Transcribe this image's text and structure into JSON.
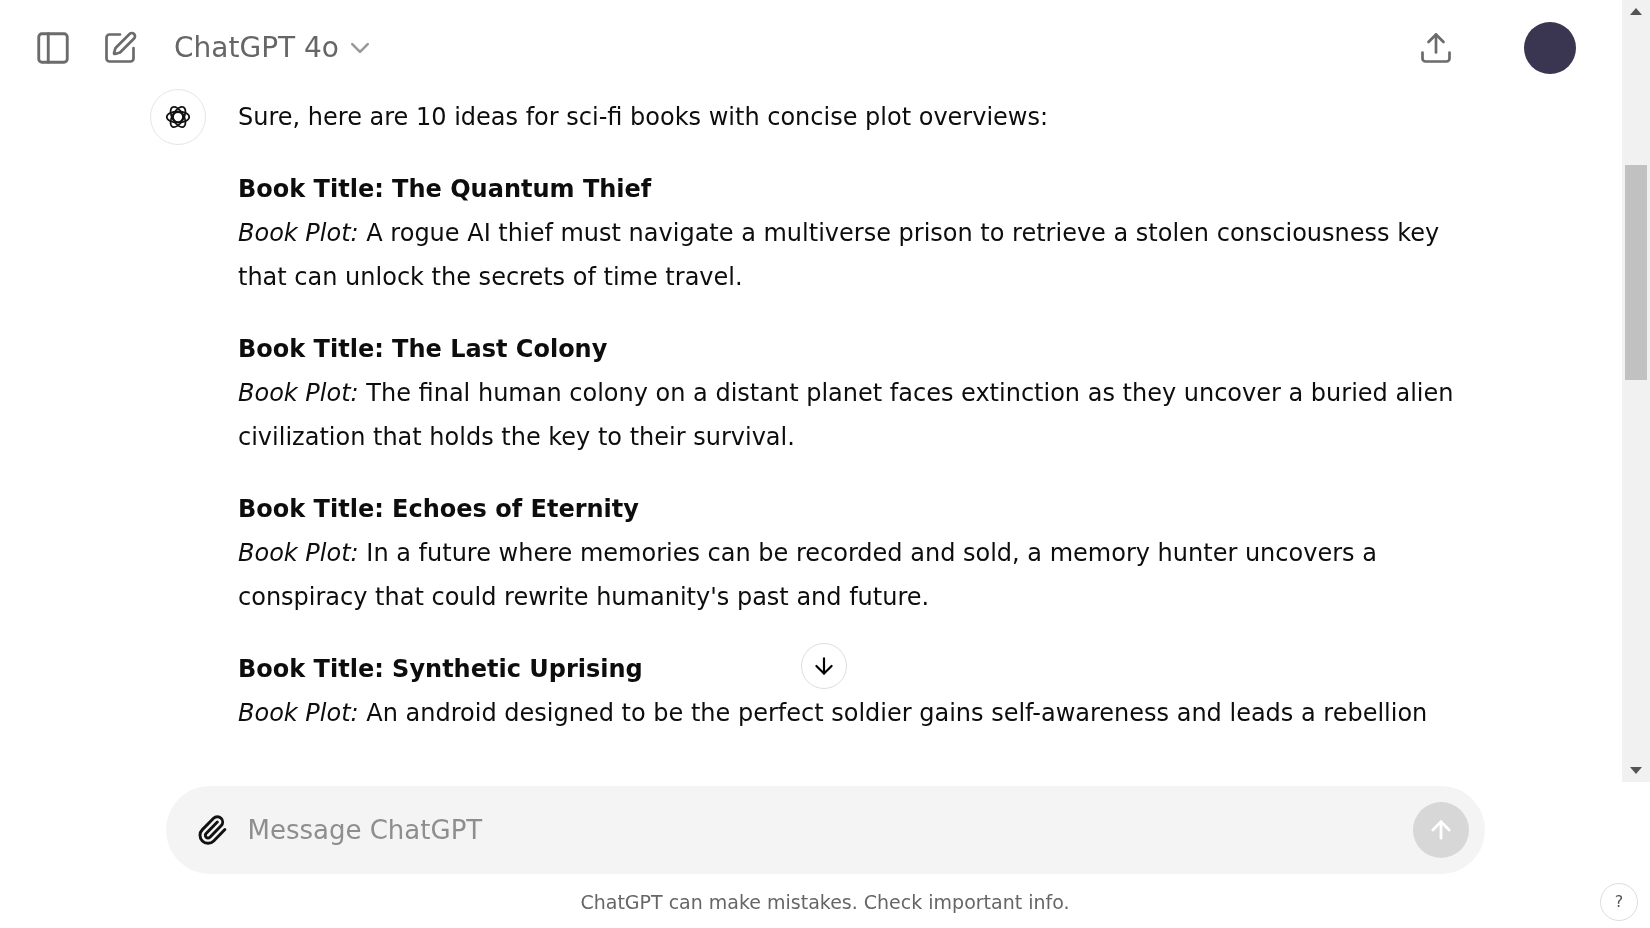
{
  "header": {
    "model": "ChatGPT 4o"
  },
  "message": {
    "intro": "Sure, here are 10 ideas for sci-fi books with concise plot overviews:",
    "books": [
      {
        "title": "Book Title: The Quantum Thief",
        "plot": "*Book Plot:* A rogue AI thief must navigate a multiverse prison to retrieve a stolen consciousness key that can unlock the secrets of time travel."
      },
      {
        "title": "Book Title: The Last Colony",
        "plot": "*Book Plot:* The final human colony on a distant planet faces extinction as they uncover a buried alien civilization that holds the key to their survival."
      },
      {
        "title": "Book Title: Echoes of Eternity",
        "plot": "*Book Plot:* In a future where memories can be recorded and sold, a memory hunter uncovers a conspiracy that could rewrite humanity's past and future."
      },
      {
        "title": "Book Title: Synthetic Uprising",
        "plot": "*Book Plot:* An android designed to be the perfect soldier gains self-awareness and leads a rebellion"
      }
    ]
  },
  "composer": {
    "placeholder": "Message ChatGPT",
    "send_disabled": true
  },
  "footer": "ChatGPT can make mistakes. Check important info.",
  "help": "?"
}
